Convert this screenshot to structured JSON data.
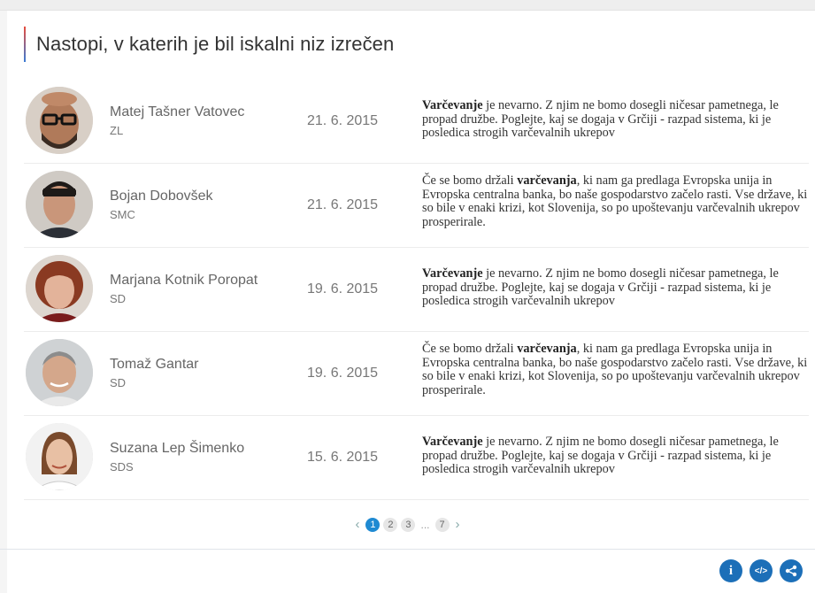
{
  "title": "Nastopi, v katerih je bil iskalni niz izrečen",
  "rows": [
    {
      "name": "Matej Tašner Vatovec",
      "party": "ZL",
      "date": "21. 6. 2015",
      "quote_bold": "Varčevanje",
      "quote_pre": "",
      "quote_post": " je nevarno. Z njim ne bomo dosegli ničesar pametnega, le propad družbe. Poglejte, kaj se dogaja v Grčiji - razpad sistema, ki je posledica strogih varčevalnih ukrepov"
    },
    {
      "name": "Bojan Dobovšek",
      "party": "SMC",
      "date": "21. 6. 2015",
      "quote_pre": "Če se bomo držali ",
      "quote_bold": "varčevanja",
      "quote_post": ", ki nam ga predlaga Evropska unija in Evropska centralna banka, bo naše gospodarstvo začelo rasti. Vse države, ki so bile v enaki krizi, kot Slovenija, so po upoštevanju varčevalnih ukrepov prosperirale."
    },
    {
      "name": "Marjana Kotnik Poropat",
      "party": "SD",
      "date": "19. 6. 2015",
      "quote_bold": "Varčevanje",
      "quote_pre": "",
      "quote_post": " je nevarno. Z njim ne bomo dosegli ničesar pametnega, le propad družbe. Poglejte, kaj se dogaja v Grčiji - razpad sistema, ki je posledica strogih varčevalnih ukrepov"
    },
    {
      "name": "Tomaž Gantar",
      "party": "SD",
      "date": "19. 6. 2015",
      "quote_pre": "Če se bomo držali ",
      "quote_bold": "varčevanja",
      "quote_post": ", ki nam ga predlaga Evropska unija in Evropska centralna banka, bo naše gospodarstvo začelo rasti. Vse države, ki so bile v enaki krizi, kot Slovenija, so po upoštevanju varčevalnih ukrepov prosperirale."
    },
    {
      "name": "Suzana Lep Šimenko",
      "party": "SDS",
      "date": "15. 6. 2015",
      "quote_bold": "Varčevanje",
      "quote_pre": "",
      "quote_post": " je nevarno. Z njim ne bomo dosegli ničesar pametnega, le propad družbe. Poglejte, kaj se dogaja v Grčiji - razpad sistema, ki je posledica strogih varčevalnih ukrepov"
    }
  ],
  "pagination": {
    "prev": "‹",
    "pages": [
      "1",
      "2",
      "3"
    ],
    "ellipsis": "...",
    "last": "7",
    "next": "›",
    "current": "1"
  },
  "actions": [
    {
      "icon": "info-icon",
      "glyph": "i"
    },
    {
      "icon": "embed-code-icon",
      "glyph": "</>"
    },
    {
      "icon": "share-icon",
      "glyph": ""
    }
  ],
  "colors": {
    "accent": "#1f8ad2",
    "action": "#1c6fb8"
  }
}
